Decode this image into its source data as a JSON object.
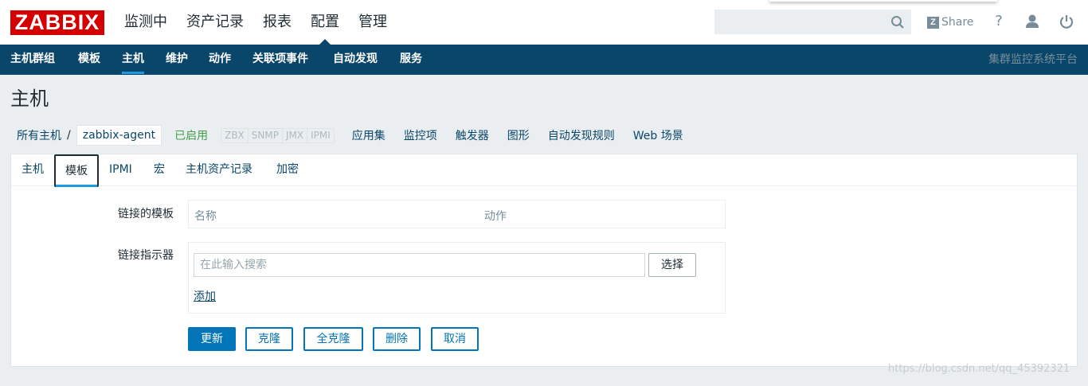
{
  "app": {
    "logo": "ZABBIX"
  },
  "top_menu": [
    {
      "label": "监测中",
      "active": false
    },
    {
      "label": "资产记录",
      "active": false
    },
    {
      "label": "报表",
      "active": false
    },
    {
      "label": "配置",
      "active": true
    },
    {
      "label": "管理",
      "active": false
    }
  ],
  "header_tools": {
    "search_value": "",
    "share_label": "Share",
    "help_label": "?"
  },
  "sub_nav": {
    "items": [
      {
        "label": "主机群组",
        "active": false
      },
      {
        "label": "模板",
        "active": false
      },
      {
        "label": "主机",
        "active": true
      },
      {
        "label": "维护",
        "active": false
      },
      {
        "label": "动作",
        "active": false
      },
      {
        "label": "关联项事件",
        "active": false
      },
      {
        "label": "自动发现",
        "active": false
      },
      {
        "label": "服务",
        "active": false
      }
    ],
    "server_name": "集群监控系统平台"
  },
  "page_title": "主机",
  "breadcrumb": {
    "all_hosts": "所有主机",
    "separator": "/",
    "current_host": "zabbix-agent",
    "status": "已启用",
    "availability": [
      "ZBX",
      "SNMP",
      "JMX",
      "IPMI"
    ],
    "links": [
      "应用集",
      "监控项",
      "触发器",
      "图形",
      "自动发现规则",
      "Web 场景"
    ]
  },
  "tabs": [
    {
      "label": "主机",
      "active": false
    },
    {
      "label": "模板",
      "active": true
    },
    {
      "label": "IPMI",
      "active": false
    },
    {
      "label": "宏",
      "active": false
    },
    {
      "label": "主机资产记录",
      "active": false
    },
    {
      "label": "加密",
      "active": false
    }
  ],
  "form": {
    "linked_templates_label": "链接的模板",
    "linked_templates_columns": [
      "名称",
      "动作"
    ],
    "link_new_label": "链接指示器",
    "search_placeholder": "在此输入搜索",
    "select_button": "选择",
    "add_link": "添加"
  },
  "buttons": {
    "update": "更新",
    "clone": "克隆",
    "full_clone": "全克隆",
    "delete": "删除",
    "cancel": "取消"
  },
  "watermark": "https://blog.csdn.net/qq_45392321",
  "colors": {
    "brand_red": "#d40000",
    "nav_blue": "#0a466a",
    "accent_blue": "#0275b8",
    "enabled_green": "#429e47"
  }
}
